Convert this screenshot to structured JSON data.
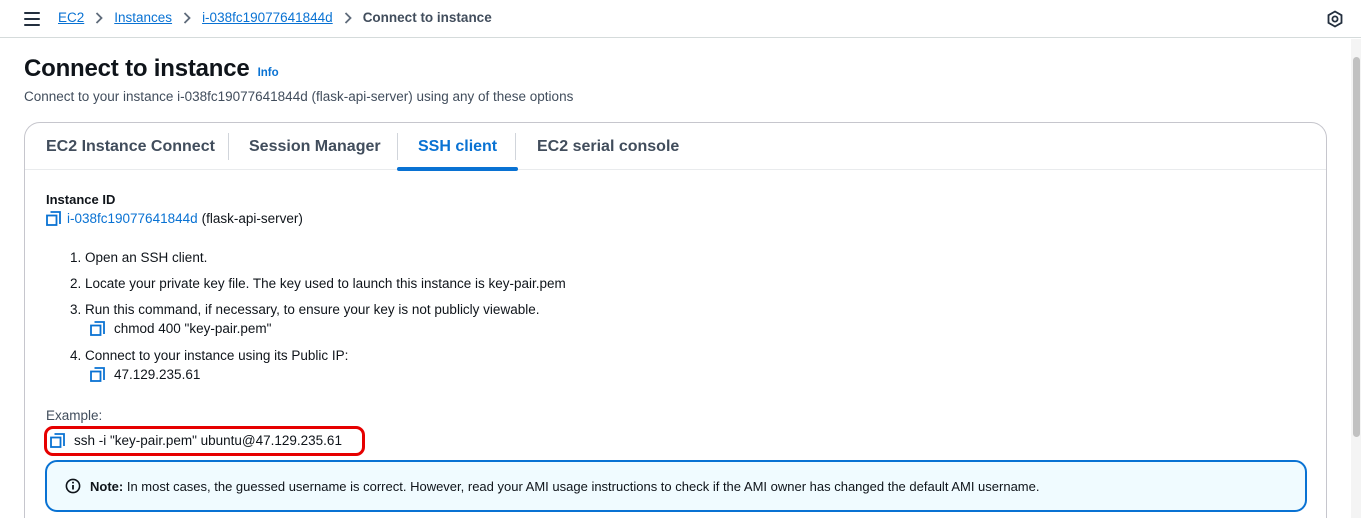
{
  "breadcrumb": {
    "items": [
      "EC2",
      "Instances",
      "i-038fc19077641844d"
    ],
    "current": "Connect to instance"
  },
  "page": {
    "title": "Connect to instance",
    "info": "Info",
    "subtitle": "Connect to your instance i-038fc19077641844d (flask-api-server) using any of these options"
  },
  "tabs": [
    "EC2 Instance Connect",
    "Session Manager",
    "SSH client",
    "EC2 serial console"
  ],
  "active_tab": "SSH client",
  "ssh": {
    "instance_id_label": "Instance ID",
    "instance_id": "i-038fc19077641844d",
    "instance_name": "(flask-api-server)",
    "steps": [
      "1. Open an SSH client.",
      "2. Locate your private key file. The key used to launch this instance is key-pair.pem",
      "3. Run this command, if necessary, to ensure your key is not publicly viewable.",
      "4. Connect to your instance using its Public IP:"
    ],
    "chmod_command": "chmod 400 \"key-pair.pem\"",
    "public_ip": "47.129.235.61",
    "example_label": "Example:",
    "example_command": "ssh -i \"key-pair.pem\" ubuntu@47.129.235.61"
  },
  "note": {
    "label": "Note:",
    "text": " In most cases, the guessed username is correct. However, read your AMI usage instructions to check if the AMI owner has changed the default AMI username."
  },
  "colors": {
    "link": "#0972d3",
    "highlight": "#e60000",
    "alert_bg": "#f0fbff"
  },
  "icons": [
    "menu-icon",
    "chevron-right-icon",
    "settings-hex-icon",
    "copy-icon",
    "info-circle-icon"
  ]
}
